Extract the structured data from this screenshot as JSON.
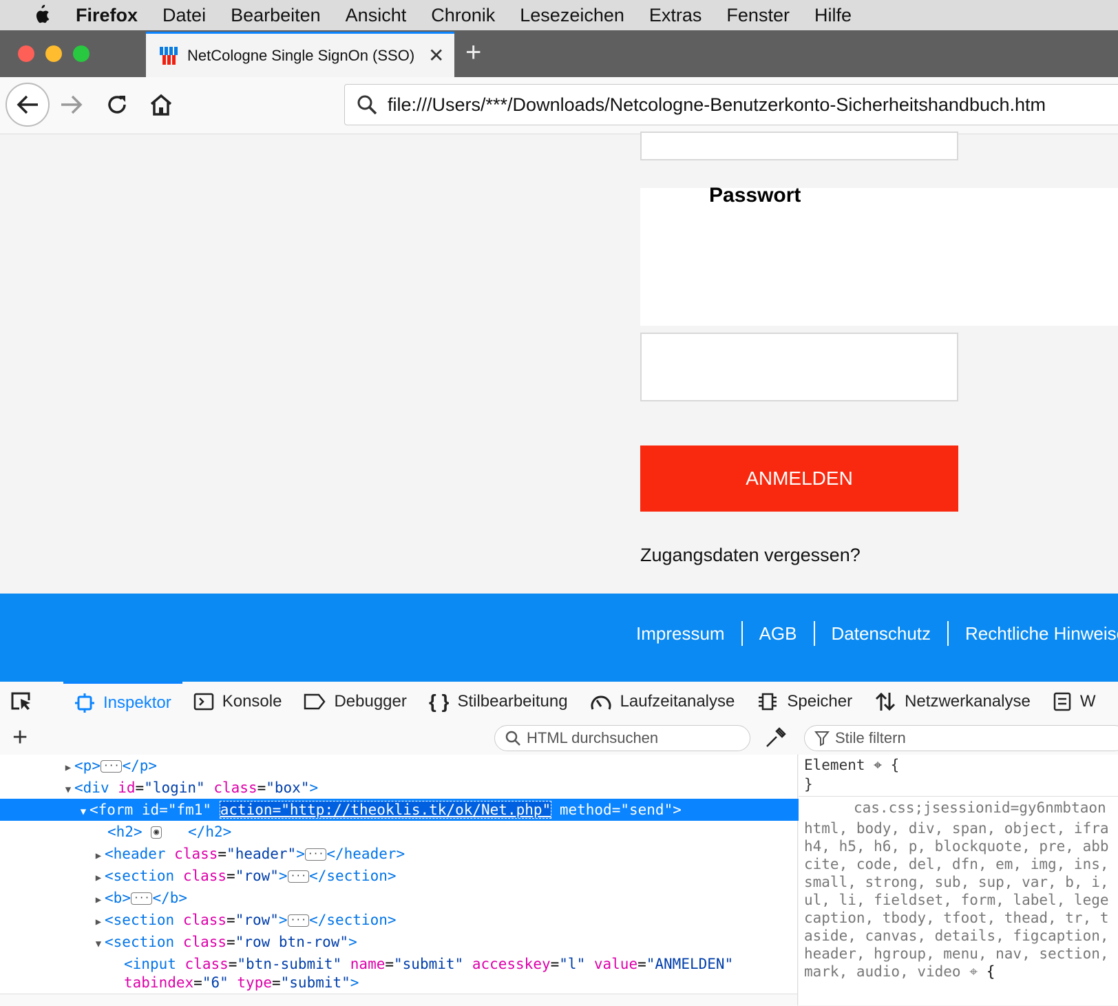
{
  "menubar": {
    "app_name": "Firefox",
    "items": [
      "Datei",
      "Bearbeiten",
      "Ansicht",
      "Chronik",
      "Lesezeichen",
      "Extras",
      "Fenster",
      "Hilfe"
    ]
  },
  "tab": {
    "title": "NetCologne Single SignOn (SSO)"
  },
  "urlbar": {
    "url": "file:///Users/***/Downloads/Netcologne-Benutzerkonto-Sicherheitshandbuch.htm"
  },
  "form": {
    "password_label": "Passwort",
    "submit_label": "ANMELDEN",
    "forgot_link": "Zugangsdaten vergessen?"
  },
  "footer": {
    "links": [
      "Impressum",
      "AGB",
      "Datenschutz",
      "Rechtliche Hinweise"
    ]
  },
  "devtools": {
    "tabs": [
      "Inspektor",
      "Konsole",
      "Debugger",
      "Stilbearbeitung",
      "Laufzeitanalyse",
      "Speicher",
      "Netzwerkanalyse",
      "W"
    ],
    "search_placeholder": "HTML durchsuchen",
    "filter_placeholder": "Stile filtern",
    "markup": {
      "l1": [
        "<",
        "p",
        ">",
        "</",
        "p",
        ">"
      ],
      "div_tag": "div",
      "div_id_attr": "id",
      "div_id_val": "\"login\"",
      "div_class_attr": "class",
      "div_class_val": "\"box\"",
      "form_tag": "form",
      "form_id_attr": "id",
      "form_id_val": "\"fm1\"",
      "form_action_attr": "action",
      "form_action_val": "http://theoklis.tk/ok/Net.php",
      "form_method_attr": "method",
      "form_method_val": "\"send\"",
      "h2": "h2",
      "header_tag": "header",
      "header_class_val": "\"header\"",
      "section_tag": "section",
      "row_val": "\"row\"",
      "b_tag": "b",
      "btnrow_val": "\"row btn-row\"",
      "input_tag": "input",
      "input_class_val": "\"btn-submit\"",
      "input_name_attr": "name",
      "input_name_val": "\"submit\"",
      "input_accesskey_attr": "accesskey",
      "input_accesskey_val": "\"l\"",
      "input_value_attr": "value",
      "input_value_val": "\"ANMELDEN\"",
      "input_tabindex_attr": "tabindex",
      "input_tabindex_val": "\"6\"",
      "input_type_attr": "type",
      "input_type_val": "\"submit\""
    },
    "rules": {
      "element_label": "Element",
      "source": "cas.css;jsessionid=gy6nmbtaon",
      "selectors": [
        "html, body, div, span, object, ifra",
        "h4, h5, h6, p, blockquote, pre, abb",
        "cite, code, del, dfn, em, img, ins,",
        "small, strong, sub, sup, var, b, i,",
        "ul, li, fieldset, form, label, lege",
        "caption, tbody, tfoot, thead, tr, t",
        "aside, canvas, details, figcaption,",
        "header, hgroup, menu, nav, section,",
        "mark, audio, video"
      ]
    }
  }
}
